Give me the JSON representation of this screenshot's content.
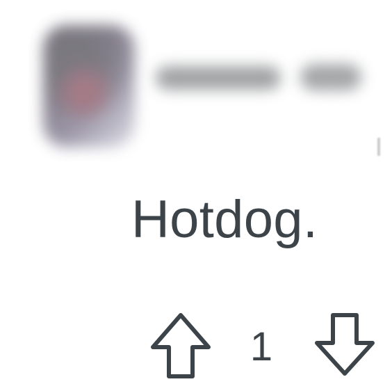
{
  "comment": {
    "text": "Hotdog."
  },
  "actions": {
    "score": "1",
    "upvote_icon": "arrow-up-icon",
    "downvote_icon": "arrow-down-icon"
  },
  "colors": {
    "text": "#3d4449",
    "icon_stroke": "#3d4449",
    "background": "#ffffff"
  }
}
